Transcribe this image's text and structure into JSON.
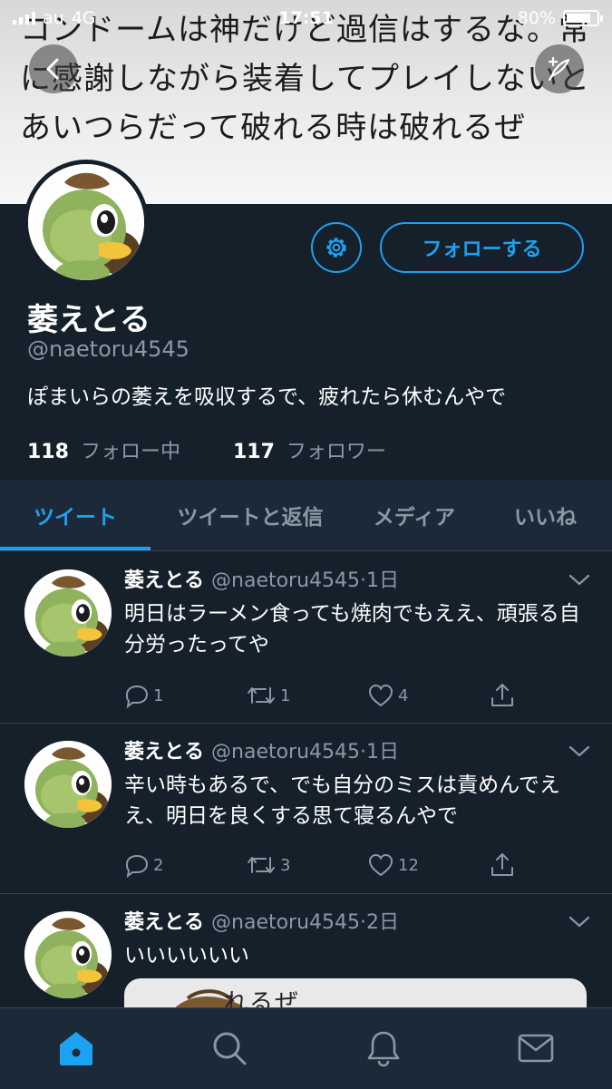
{
  "status_bar": {
    "carrier": "au",
    "network": "4G",
    "time": "17:51",
    "battery": "80%",
    "battery_level": 0.8
  },
  "banner": {
    "text": "コンドームは神だけど過信はするな。常に感謝しながら装着してプレイしないとあいつらだって破れる時は破れるぜ"
  },
  "profile": {
    "name": "萎えとる",
    "handle": "@naetoru4545",
    "bio": "ぽまいらの萎えを吸収するで、疲れたら休むんやで",
    "following_count": "118",
    "following_label": "フォロー中",
    "followers_count": "117",
    "followers_label": "フォロワー",
    "follow_button": "フォローする"
  },
  "tabs": [
    {
      "label": "ツイート",
      "active": true
    },
    {
      "label": "ツイートと返信",
      "active": false
    },
    {
      "label": "メディア",
      "active": false
    },
    {
      "label": "いいね",
      "active": false
    }
  ],
  "tweets": [
    {
      "name": "萎えとる",
      "handle": "@naetoru4545",
      "time": "1日",
      "text": "明日はラーメン食っても焼肉でもええ、頑張る自分労ったってや",
      "replies": "1",
      "retweets": "1",
      "likes": "4"
    },
    {
      "name": "萎えとる",
      "handle": "@naetoru4545",
      "time": "1日",
      "text": "辛い時もあるで、でも自分のミスは責めんでええ、明日を良くする思て寝るんやで",
      "replies": "2",
      "retweets": "3",
      "likes": "12"
    },
    {
      "name": "萎えとる",
      "handle": "@naetoru4545",
      "time": "2日",
      "text": "いいいいいい",
      "media_text": "れるぜ"
    }
  ],
  "colors": {
    "background": "#15202b",
    "accent": "#1da1f2",
    "muted": "#8899a6",
    "divider": "#38444d"
  },
  "icons": {
    "nav": [
      "back-icon",
      "compose-icon"
    ],
    "tweet_actions": [
      "reply-icon",
      "retweet-icon",
      "like-icon",
      "share-icon"
    ],
    "bottom_nav": [
      "home-icon",
      "search-icon",
      "notifications-icon",
      "messages-icon"
    ]
  }
}
